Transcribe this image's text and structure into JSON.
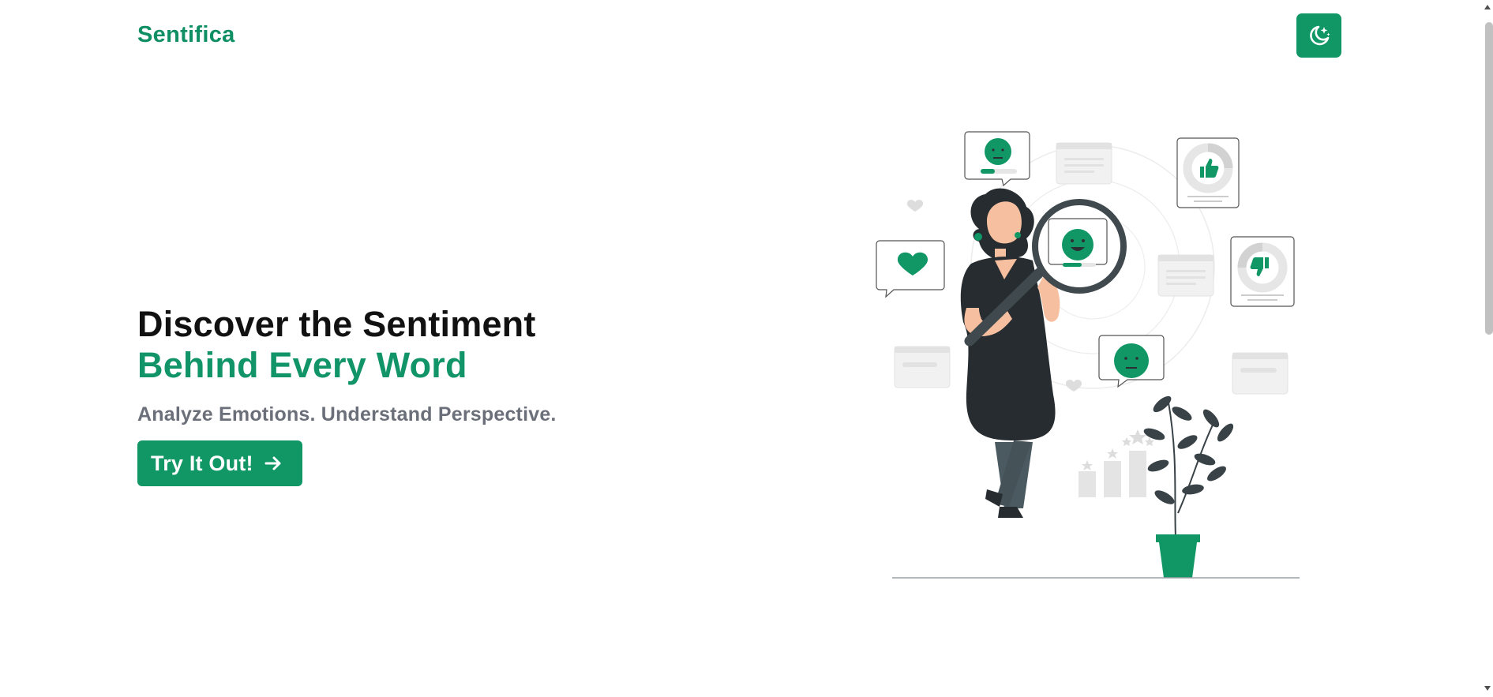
{
  "header": {
    "brand": "Sentifica",
    "theme_toggle_icon": "moon-stars-icon"
  },
  "hero": {
    "title_line1": "Discover the Sentiment",
    "title_line2": "Behind Every Word",
    "subtitle": "Analyze Emotions. Understand Perspective.",
    "cta_label": "Try It Out!",
    "cta_icon": "arrow-right-icon"
  },
  "illustration": {
    "icon": "sentiment-analysis-illustration"
  },
  "colors": {
    "accent": "#109765",
    "heading": "#111111",
    "subtitle": "#6b6f79",
    "background": "#ffffff"
  }
}
